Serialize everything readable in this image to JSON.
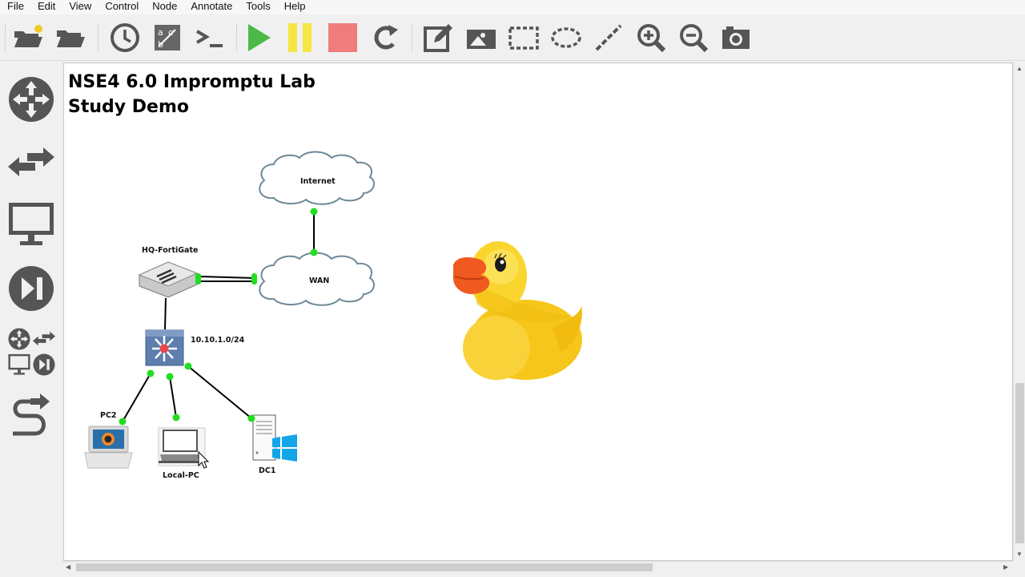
{
  "menubar": {
    "items": [
      "File",
      "Edit",
      "View",
      "Control",
      "Node",
      "Annotate",
      "Tools",
      "Help"
    ]
  },
  "toolbar": {
    "icons": [
      "open-project-icon",
      "open-folder-icon",
      "snapshot-clock-icon",
      "show-interface-labels-icon",
      "console-icon",
      "start-icon",
      "pause-icon",
      "stop-icon",
      "reload-icon",
      "add-note-icon",
      "insert-picture-icon",
      "draw-rectangle-icon",
      "draw-ellipse-icon",
      "draw-line-icon",
      "zoom-in-icon",
      "zoom-out-icon",
      "screenshot-icon"
    ],
    "colors": {
      "start": "#4cb848",
      "pause": "#f5e642",
      "stop": "#f07c7c",
      "icon": "#555555"
    }
  },
  "sidebar": {
    "icons": [
      "routers-icon",
      "switches-icon",
      "end-devices-icon",
      "security-devices-icon",
      "all-devices-icon",
      "add-link-icon"
    ]
  },
  "canvas": {
    "title_line1": "NSE4 6.0 Impromptu Lab",
    "title_line2": "Study Demo",
    "nodes": {
      "internet": "Internet",
      "wan": "WAN",
      "fortigate": "HQ-FortiGate",
      "switch_subnet": "10.10.1.0/24",
      "pc2": "PC2",
      "local_pc": "Local-PC",
      "dc1": "DC1"
    },
    "link_color": "#000000",
    "port_color": "#22dd22"
  }
}
